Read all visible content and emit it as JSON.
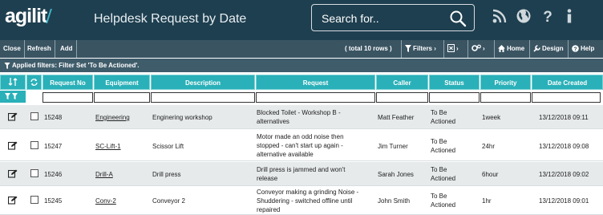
{
  "header": {
    "logo_text": "agilit",
    "title": "Helpdesk Request by Date",
    "search_placeholder": "Search for..",
    "icons": [
      "rss-icon",
      "globe-icon",
      "help-icon",
      "info-icon"
    ]
  },
  "toolbar": {
    "close_label": "Close",
    "refresh_label": "Refresh",
    "add_label": "Add",
    "total_label": "( total 10 rows )",
    "filters_label": "Filters",
    "home_label": "Home",
    "design_label": "Design",
    "help_label": "Help"
  },
  "filter_bar": {
    "text": "Applied filters: Filter Set 'To Be Actioned'."
  },
  "grid": {
    "columns": [
      "Request No",
      "Equipment",
      "Description",
      "Request",
      "Caller",
      "Status",
      "Priority",
      "Date Created"
    ],
    "rows": [
      {
        "request_no": "15248",
        "equipment": "Engineering",
        "description": "Enginering workshop",
        "request": [
          "Blocked Toilet - Workshop B -",
          "alternatives"
        ],
        "caller": "Matt Feather",
        "status": [
          "To Be",
          "Actioned"
        ],
        "priority": "1week",
        "date_created": "13/12/2018 09:11"
      },
      {
        "request_no": "15247",
        "equipment": "SC-Lift-1",
        "description": "Scissor Lift",
        "request": [
          "Motor made an odd noise then",
          "stopped - can't start up again -",
          "alternative available"
        ],
        "caller": "Jim Turner",
        "status": [
          "To Be",
          "Actioned"
        ],
        "priority": "24hr",
        "date_created": "13/12/2018 09:08"
      },
      {
        "request_no": "15246",
        "equipment": "Drill-A",
        "description": "Drill press",
        "request": [
          "Drill press is jammed and won't",
          "release"
        ],
        "caller": "Sarah Jones",
        "status": [
          "To Be",
          "Actioned"
        ],
        "priority": "6hour",
        "date_created": "13/12/2018 09:02"
      },
      {
        "request_no": "15245",
        "equipment": "Conv-2",
        "description": "Conveyor 2",
        "request": [
          "Conveyor making a grinding Noise -",
          "Shuddering - switched offline until",
          "repaired"
        ],
        "caller": "John Smith",
        "status": [
          "To Be",
          "Actioned"
        ],
        "priority": "1hr",
        "date_created": "13/12/2018 09:01"
      }
    ]
  },
  "colors": {
    "header_bg": "#1e3f4f",
    "toolbar_bg": "#3a5462",
    "grid_header_bg": "#2ab0b8",
    "accent": "#3fb6c8"
  }
}
